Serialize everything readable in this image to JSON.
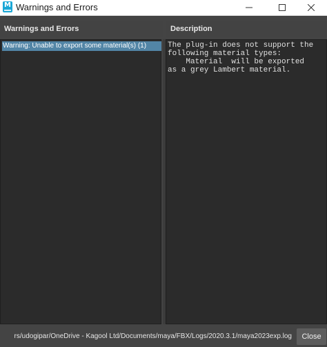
{
  "window": {
    "title": "Warnings and Errors",
    "app_icon_letter": "M",
    "app_icon_name": "maya-app-icon",
    "min_icon": "minimize-icon",
    "max_icon": "maximize-icon",
    "close_icon": "close-icon"
  },
  "left_panel": {
    "header": "Warnings and Errors",
    "items": [
      {
        "label": "Warning: Unable to export some material(s) (1)",
        "selected": true
      }
    ]
  },
  "right_panel": {
    "header": "Description",
    "text": "The plug-in does not support the\nfollowing material types:\n    Material  will be exported\nas a grey Lambert material."
  },
  "bottom_bar": {
    "log_path": "rs/udogipar/OneDrive - Kagool Ltd/Documents/maya/FBX/Logs/2020.3.1/maya2023exp.log",
    "close_label": "Close"
  },
  "colors": {
    "background": "#444444",
    "pane": "#2b2b2b",
    "selection": "#5285a6",
    "app_icon": "#1aa7d6"
  }
}
